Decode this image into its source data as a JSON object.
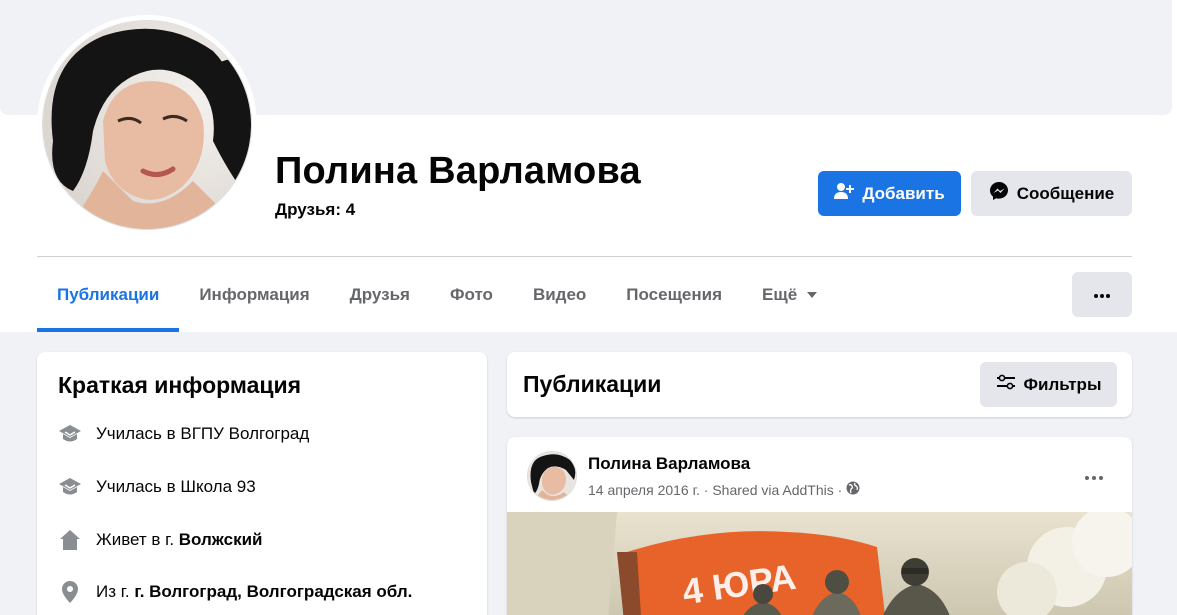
{
  "profile": {
    "name": "Полина Варламова",
    "friends": "Друзья: 4",
    "add_label": "Добавить",
    "message_label": "Сообщение"
  },
  "tabs": [
    {
      "label": "Публикации",
      "active": true
    },
    {
      "label": "Информация"
    },
    {
      "label": "Друзья"
    },
    {
      "label": "Фото"
    },
    {
      "label": "Видео"
    },
    {
      "label": "Посещения"
    },
    {
      "label": "Ещё"
    }
  ],
  "intro": {
    "title": "Краткая информация",
    "items": [
      {
        "icon": "education-cap-icon",
        "text": "Училась в ВГПУ Волгоград",
        "prefix": "",
        "bold": ""
      },
      {
        "icon": "education-cap-icon",
        "text": "Училась в Школа 93",
        "prefix": "",
        "bold": ""
      },
      {
        "icon": "home-icon",
        "text": "",
        "prefix": "Живет в г. ",
        "bold": "Волжский"
      },
      {
        "icon": "location-pin-icon",
        "text": "",
        "prefix": "Из г. ",
        "bold": "г. Волгоград, Волгоградская обл."
      }
    ]
  },
  "publications": {
    "title": "Публикации",
    "filter_label": "Фильтры"
  },
  "post": {
    "author": "Полина Варламова",
    "meta": "14 апреля 2016 г. · Shared via AddThis ·",
    "privacy_icon": "globe-icon",
    "banner_text": "4 ЮРА"
  },
  "colors": {
    "accent": "#1b74e4",
    "background": "#f0f2f5",
    "secondary_text": "#65676b",
    "button_gray": "#e4e6eb",
    "flag_orange": "#e8632a"
  }
}
